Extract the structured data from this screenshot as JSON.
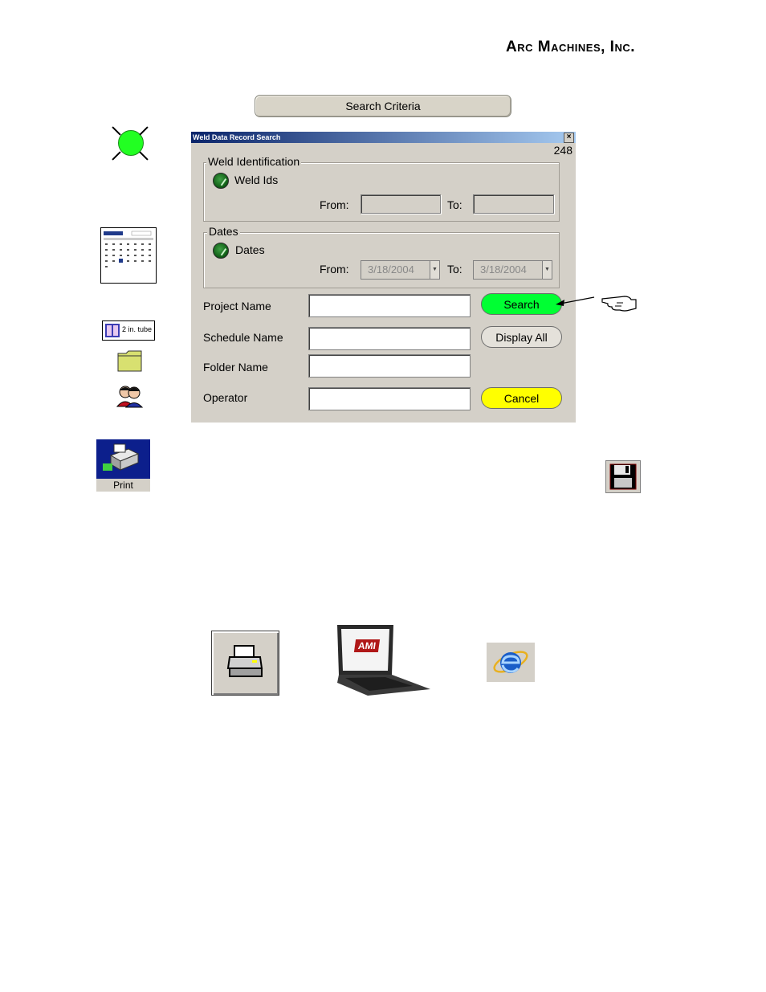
{
  "company": "Arc Machines, Inc.",
  "criteria_label": "Search Criteria",
  "dialog": {
    "title": "Weld Data Record Search",
    "close_glyph": "×",
    "record_count": "248",
    "weld_identification": {
      "group_label": "Weld Identification",
      "option_label": "Weld Ids",
      "from_label": "From:",
      "to_label": "To:",
      "from_value": "",
      "to_value": ""
    },
    "dates": {
      "group_label": "Dates",
      "option_label": "Dates",
      "from_label": "From:",
      "to_label": "To:",
      "from_value": "3/18/2004",
      "to_value": "3/18/2004"
    },
    "fields": {
      "project_name": "Project Name",
      "schedule_name": "Schedule Name",
      "folder_name": "Folder Name",
      "operator": "Operator"
    },
    "buttons": {
      "search": "Search",
      "display_all": "Display All",
      "cancel": "Cancel"
    }
  },
  "icons": {
    "tube_label": "2 in. tube",
    "print_label": "Print",
    "laptop_logo": "AMI"
  },
  "colors": {
    "search_button": "#00ff33",
    "cancel_button": "#ffff00",
    "indicator_light": "#22ff22",
    "dialog_bg": "#d4d0c8"
  }
}
